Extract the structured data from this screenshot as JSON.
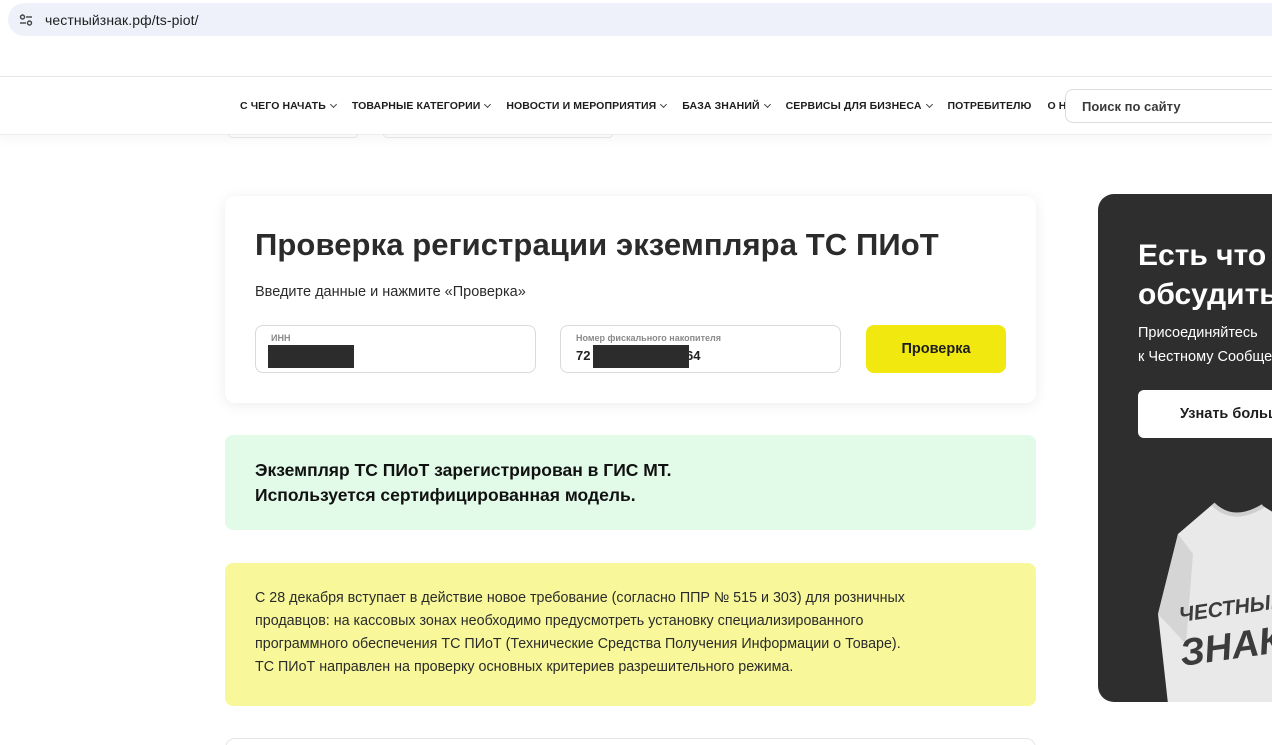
{
  "browser": {
    "url": "честныйзнак.рф/ts-piot/"
  },
  "nav": {
    "items": [
      {
        "label": "С ЧЕГО НАЧАТЬ",
        "has_dropdown": true
      },
      {
        "label": "ТОВАРНЫЕ КАТЕГОРИИ",
        "has_dropdown": true
      },
      {
        "label": "НОВОСТИ И МЕРОПРИЯТИЯ",
        "has_dropdown": true
      },
      {
        "label": "БАЗА ЗНАНИЙ",
        "has_dropdown": true
      },
      {
        "label": "СЕРВИСЫ ДЛЯ БИЗНЕСА",
        "has_dropdown": true
      },
      {
        "label": "ПОТРЕБИТЕЛЮ",
        "has_dropdown": false
      },
      {
        "label": "О НАС",
        "has_dropdown": true
      }
    ],
    "search_placeholder": "Поиск по сайту"
  },
  "check_form": {
    "title": "Проверка регистрации экземпляра ТС ПИоТ",
    "subtitle": "Введите данные и нажмите «Проверка»",
    "inn_label": "ИНН",
    "fn_label": "Номер фискального накопителя",
    "fn_value_prefix": "72",
    "fn_value_suffix": "64",
    "submit_label": "Проверка"
  },
  "result": {
    "line1": "Экземпляр ТС ПИоТ зарегистрирован в ГИС МТ.",
    "line2": "Используется сертифицированная модель."
  },
  "notice": {
    "lines": [
      "С 28 декабря вступает в действие новое требование (согласно ППР № 515 и 303) для розничных",
      "продавцов: на кассовых зонах необходимо предусмотреть установку специализированного",
      "программного обеспечения ТС ПИоТ (Технические Средства Получения Информации о Товаре).",
      "ТС ПИоТ направлен на проверку основных критериев разрешительного режима."
    ]
  },
  "promo": {
    "title_line1": "Есть что",
    "title_line2": "обсудить?",
    "text_line1": "Присоединяйтесь",
    "text_line2": "к Честному Сообществу",
    "button_label": "Узнать больше",
    "shirt_text_line1": "ЧЕСТНЫЙ",
    "shirt_text_line2": "ЗНАК"
  },
  "colors": {
    "accent_yellow": "#f0e80e",
    "success_bg": "#e2fbe9",
    "notice_bg": "#f8f89b",
    "promo_bg": "#2e2e2e"
  }
}
